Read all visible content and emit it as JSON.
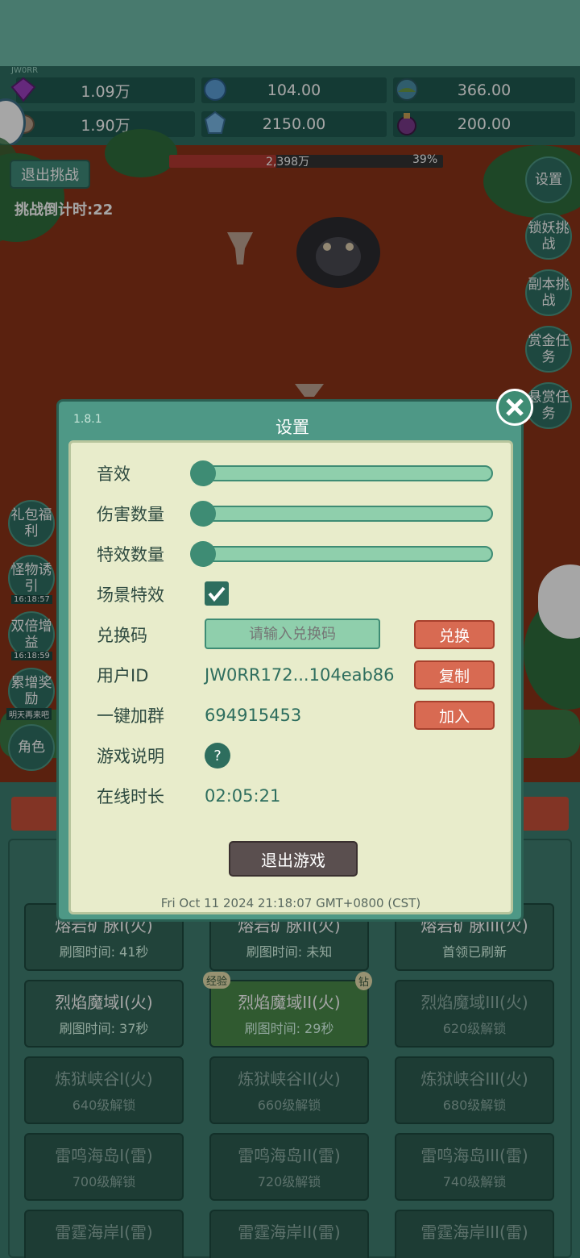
{
  "resources": [
    {
      "icon": "purple-gem-icon",
      "value": "1.09万"
    },
    {
      "icon": "blue-crystal-icon",
      "value": "104.00"
    },
    {
      "icon": "globe-orb-icon",
      "value": "366.00"
    },
    {
      "icon": "stone-icon",
      "value": "1.90万"
    },
    {
      "icon": "ice-crystal-icon",
      "value": "2150.00"
    },
    {
      "icon": "potion-icon",
      "value": "200.00"
    }
  ],
  "uid_tiny": "JW0RR",
  "battle": {
    "exit_label": "退出挑战",
    "countdown": "挑战倒计时:22",
    "boss_hp": "2,398万",
    "boss_percent": "39%",
    "boss_fraction": 0.39
  },
  "right_buttons": [
    "设置",
    "锁妖挑战",
    "副本挑战",
    "赏金任务",
    "悬赏任务"
  ],
  "left_buttons": [
    {
      "label": "礼包福利",
      "timer": ""
    },
    {
      "label": "怪物诱引",
      "timer": "16:18:57"
    },
    {
      "label": "双倍增益",
      "timer": "16:18:59"
    },
    {
      "label": "累增奖励",
      "timer": "明天再来吧"
    },
    {
      "label": "角色",
      "timer": ""
    }
  ],
  "help_glyph": "?",
  "cards": [
    {
      "name": "熔岩矿脉I(火)",
      "sub": "刷图时间: 41秒",
      "state": "normal"
    },
    {
      "name": "熔岩矿脉II(火)",
      "sub": "刷图时间: 未知",
      "state": "normal"
    },
    {
      "name": "熔岩矿脉III(火)",
      "sub": "首领已刷新",
      "state": "normal"
    },
    {
      "name": "烈焰魔域I(火)",
      "sub": "刷图时间: 37秒",
      "state": "normal"
    },
    {
      "name": "烈焰魔域II(火)",
      "sub": "刷图时间: 29秒",
      "state": "active",
      "badge_left": "经验",
      "badge_right": "钻"
    },
    {
      "name": "烈焰魔域III(火)",
      "sub": "620级解锁",
      "state": "locked"
    },
    {
      "name": "炼狱峡谷I(火)",
      "sub": "640级解锁",
      "state": "locked"
    },
    {
      "name": "炼狱峡谷II(火)",
      "sub": "660级解锁",
      "state": "locked"
    },
    {
      "name": "炼狱峡谷III(火)",
      "sub": "680级解锁",
      "state": "locked"
    },
    {
      "name": "雷鸣海岛I(雷)",
      "sub": "700级解锁",
      "state": "locked"
    },
    {
      "name": "雷鸣海岛II(雷)",
      "sub": "720级解锁",
      "state": "locked"
    },
    {
      "name": "雷鸣海岛III(雷)",
      "sub": "740级解锁",
      "state": "locked"
    },
    {
      "name": "雷霆海岸I(雷)",
      "sub": "",
      "state": "locked"
    },
    {
      "name": "雷霆海岸II(雷)",
      "sub": "",
      "state": "locked"
    },
    {
      "name": "雷霆海岸III(雷)",
      "sub": "",
      "state": "locked"
    }
  ],
  "settings": {
    "version": "1.8.1",
    "title": "设置",
    "labels": {
      "sound": "音效",
      "damage": "伤害数量",
      "effects": "特效数量",
      "scene": "场景特效",
      "redeem": "兑换码",
      "userid": "用户ID",
      "group": "一键加群",
      "guide": "游戏说明",
      "online": "在线时长"
    },
    "sliders": {
      "sound": 0,
      "damage": 0,
      "effects": 0
    },
    "scene_checked": true,
    "redeem_placeholder": "请输入兑换码",
    "redeem_btn": "兑换",
    "userid_value": "JW0RR172...104eab86",
    "copy_btn": "复制",
    "group_value": "694915453",
    "join_btn": "加入",
    "guide_glyph": "?",
    "online_value": "02:05:21",
    "quit_btn": "退出游戏",
    "timestamp": "Fri Oct 11 2024 21:18:07 GMT+0800 (CST)"
  }
}
